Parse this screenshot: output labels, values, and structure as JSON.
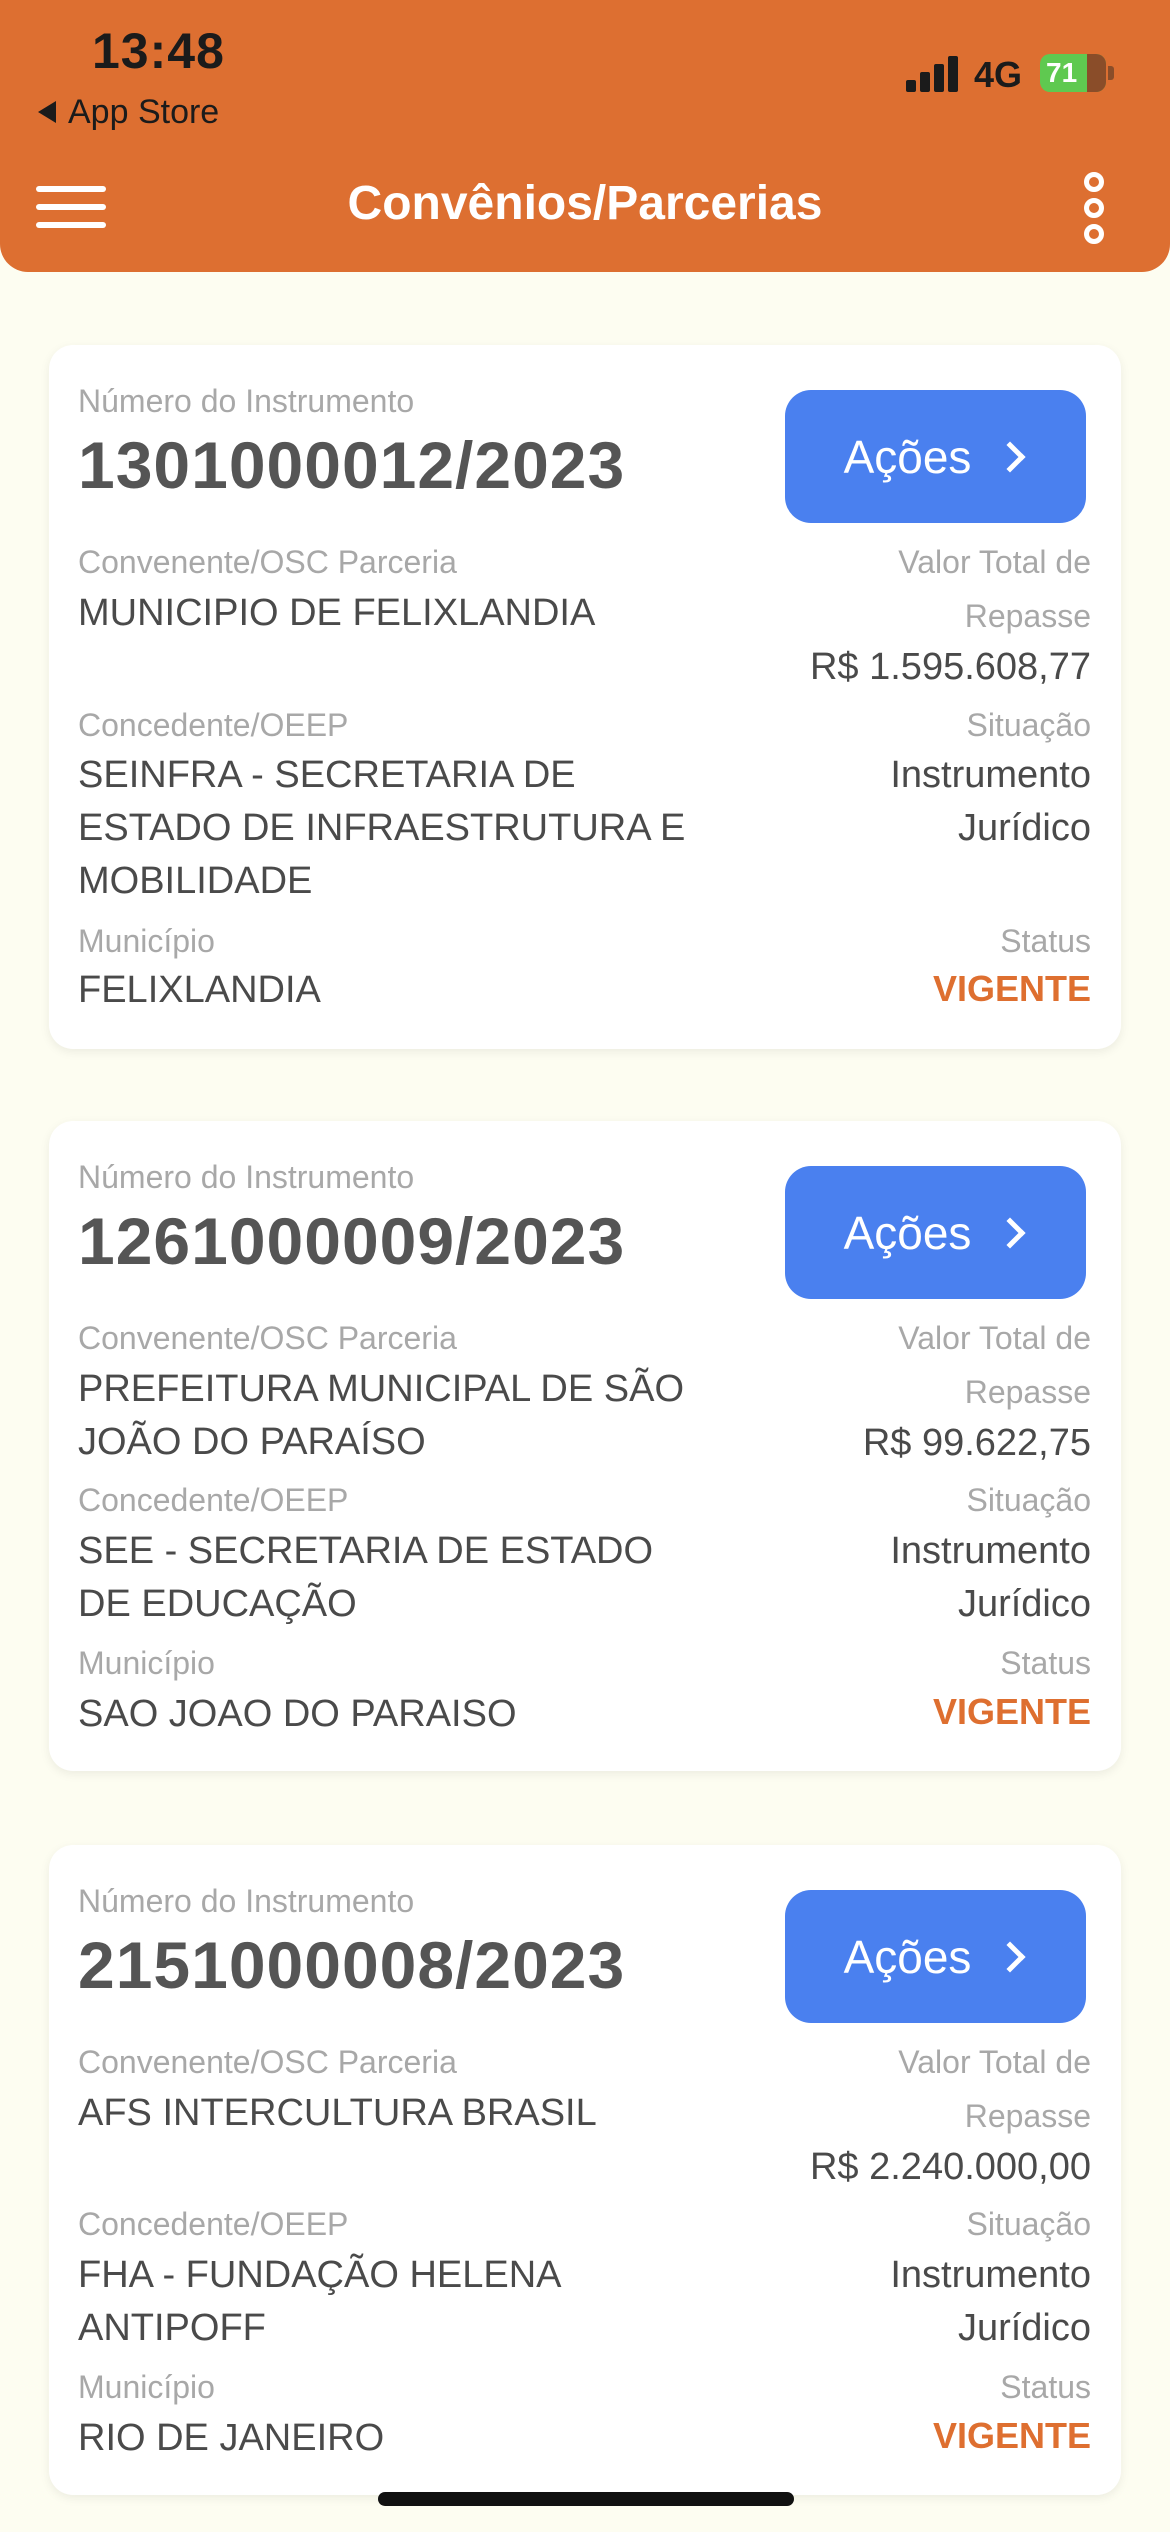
{
  "status_bar": {
    "time": "13:48",
    "back_label": "App Store",
    "network": "4G",
    "battery": "71",
    "battery_level": 0.71
  },
  "app_bar": {
    "title": "Convênios/Parcerias",
    "menu_icon": "hamburger-menu-icon",
    "more_icon": "vertical-dots-icon"
  },
  "labels": {
    "numero": "Número do Instrumento",
    "convenente": "Convenente/OSC Parceria",
    "valor_line1": "Valor Total de",
    "valor_line2": "Repasse",
    "concedente": "Concedente/OEEP",
    "situacao": "Situação",
    "municipio": "Município",
    "status": "Status",
    "acoes": "Ações"
  },
  "colors": {
    "header": "#dd6f31",
    "action_button": "#4a80ef",
    "status_text": "#de6f30",
    "background": "#fdfdf1"
  },
  "cards": [
    {
      "numero": "1301000012/2023",
      "convenente": [
        "MUNICIPIO DE FELIXLANDIA"
      ],
      "valor": "R$ 1.595.608,77",
      "concedente": [
        "SEINFRA - SECRETARIA DE",
        "ESTADO DE INFRAESTRUTURA E",
        "MOBILIDADE"
      ],
      "situacao": [
        "Instrumento",
        "Jurídico"
      ],
      "municipio": "FELIXLANDIA",
      "status": "VIGENTE"
    },
    {
      "numero": "1261000009/2023",
      "convenente": [
        "PREFEITURA MUNICIPAL DE SÃO",
        "JOÃO DO PARAÍSO"
      ],
      "valor": "R$ 99.622,75",
      "concedente": [
        "SEE - SECRETARIA DE ESTADO",
        "DE EDUCAÇÃO"
      ],
      "situacao": [
        "Instrumento",
        "Jurídico"
      ],
      "municipio": "SAO JOAO DO PARAISO",
      "status": "VIGENTE"
    },
    {
      "numero": "2151000008/2023",
      "convenente": [
        "AFS INTERCULTURA BRASIL"
      ],
      "valor": "R$ 2.240.000,00",
      "concedente": [
        "FHA - FUNDAÇÃO HELENA",
        "ANTIPOFF"
      ],
      "situacao": [
        "Instrumento",
        "Jurídico"
      ],
      "municipio": "RIO DE JANEIRO",
      "status": "VIGENTE"
    }
  ]
}
